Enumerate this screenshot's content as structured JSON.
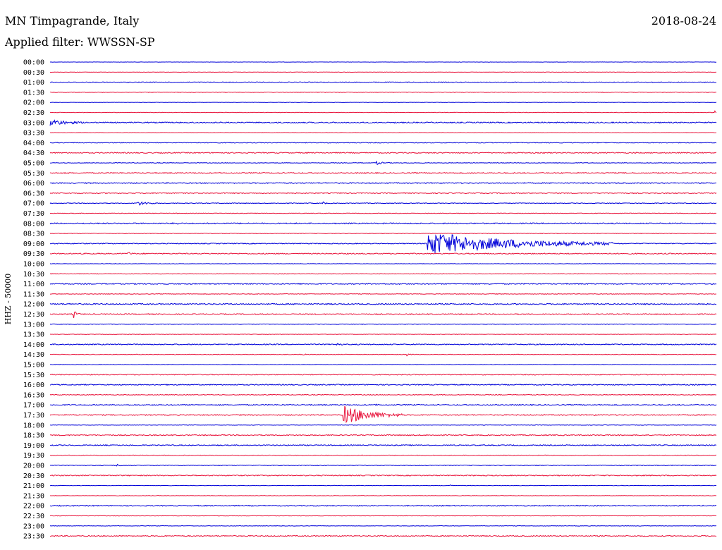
{
  "header": {
    "station": "MN Timpagrande, Italy",
    "date": "2018-08-24",
    "filter": "Applied filter: WWSSN-SP"
  },
  "chart_data": {
    "type": "line",
    "ylabel": "HHZ - 50000",
    "row_labels": [
      "00:00",
      "00:30",
      "01:00",
      "01:30",
      "02:00",
      "02:30",
      "03:00",
      "03:30",
      "04:00",
      "04:30",
      "05:00",
      "05:30",
      "06:00",
      "06:30",
      "07:00",
      "07:30",
      "08:00",
      "08:30",
      "09:00",
      "09:30",
      "10:00",
      "10:30",
      "11:00",
      "11:30",
      "12:00",
      "12:30",
      "13:00",
      "13:30",
      "14:00",
      "14:30",
      "15:00",
      "15:30",
      "16:00",
      "16:30",
      "17:00",
      "17:30",
      "18:00",
      "18:30",
      "19:00",
      "19:30",
      "20:00",
      "20:30",
      "21:00",
      "21:30",
      "22:00",
      "22:30",
      "23:00",
      "23:30"
    ],
    "colors": [
      "#0000d8",
      "#e8143c"
    ],
    "noise": [
      0.2,
      0.2,
      0.5,
      0.4,
      0.2,
      0.3,
      0.8,
      0.3,
      0.5,
      0.7,
      0.4,
      0.7,
      0.7,
      0.6,
      0.5,
      0.4,
      0.8,
      0.4,
      0.6,
      0.7,
      0.3,
      0.4,
      0.7,
      0.4,
      0.8,
      0.7,
      0.4,
      0.3,
      0.7,
      0.4,
      0.4,
      0.6,
      0.7,
      0.5,
      0.7,
      0.7,
      0.3,
      0.7,
      0.7,
      0.4,
      0.5,
      0.7,
      0.3,
      0.3,
      0.7,
      0.3,
      0.3,
      0.7
    ],
    "events": [
      {
        "row": 5,
        "t": 0.997,
        "amp": 4,
        "dur": 0.003
      },
      {
        "row": 6,
        "t": 0.0,
        "amp": 4,
        "dur": 0.05
      },
      {
        "row": 10,
        "t": 0.49,
        "amp": 2,
        "dur": 0.02
      },
      {
        "row": 14,
        "t": 0.13,
        "amp": 3,
        "dur": 0.03
      },
      {
        "row": 14,
        "t": 0.41,
        "amp": 2,
        "dur": 0.005
      },
      {
        "row": 16,
        "t": 0.19,
        "amp": 2,
        "dur": 0.005
      },
      {
        "row": 18,
        "t": 0.565,
        "amp": 15,
        "dur": 0.28
      },
      {
        "row": 19,
        "t": 0.115,
        "amp": 3,
        "dur": 0.01
      },
      {
        "row": 25,
        "t": 0.035,
        "amp": 5,
        "dur": 0.01
      },
      {
        "row": 28,
        "t": 0.43,
        "amp": 2,
        "dur": 0.01
      },
      {
        "row": 29,
        "t": 0.38,
        "amp": 2,
        "dur": 0.005
      },
      {
        "row": 29,
        "t": 0.535,
        "amp": 2,
        "dur": 0.01
      },
      {
        "row": 34,
        "t": 0.49,
        "amp": 2,
        "dur": 0.005
      },
      {
        "row": 35,
        "t": 0.44,
        "amp": 12,
        "dur": 0.09
      },
      {
        "row": 35,
        "t": 0.815,
        "amp": 2,
        "dur": 0.005
      },
      {
        "row": 40,
        "t": 0.1,
        "amp": 1.5,
        "dur": 0.01
      },
      {
        "row": 42,
        "t": 0.6,
        "amp": 2,
        "dur": 0.005
      }
    ]
  }
}
